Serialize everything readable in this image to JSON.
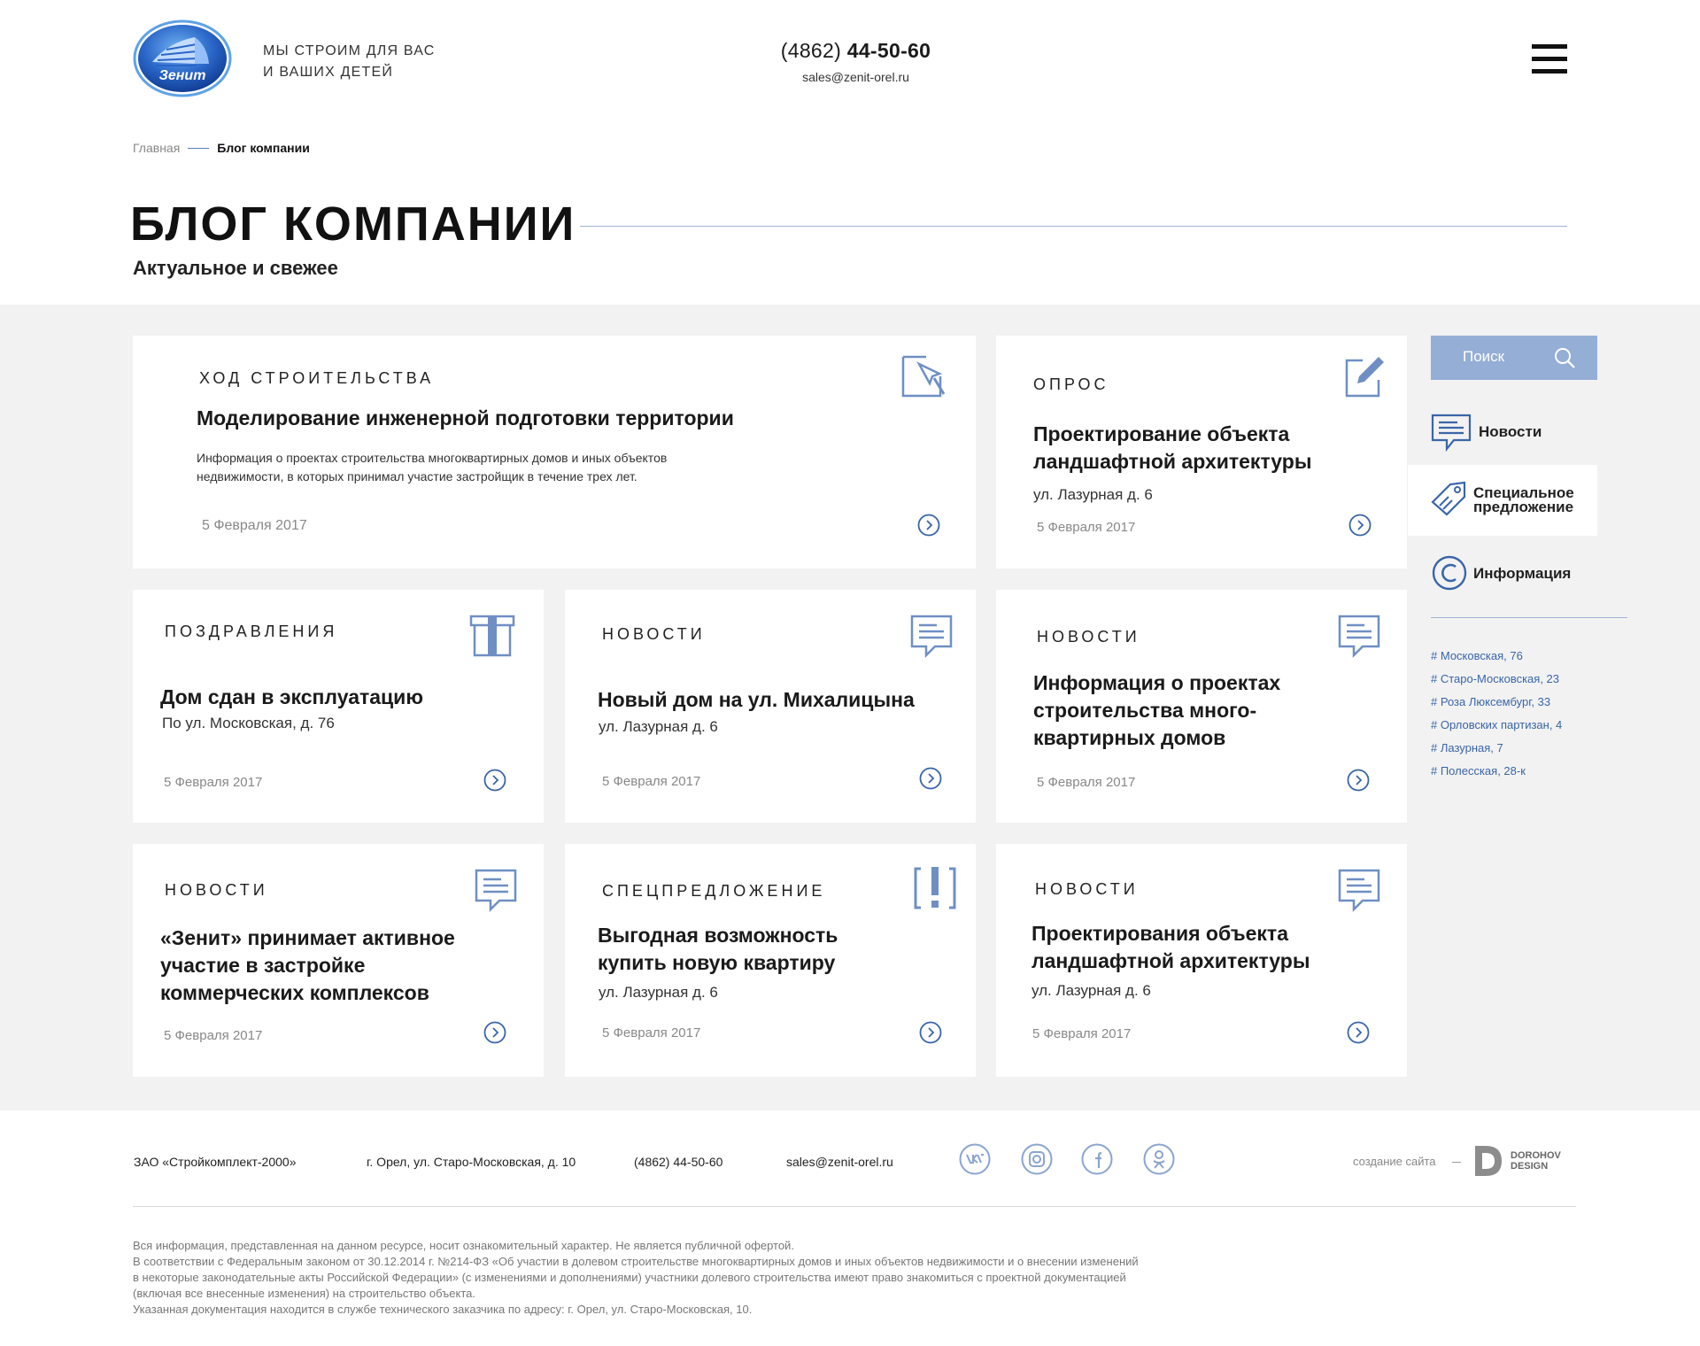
{
  "header": {
    "logo_text": "Зенит",
    "slogan_line1": "МЫ СТРОИМ ДЛЯ ВАС",
    "slogan_line2": "И ВАШИХ ДЕТЕЙ",
    "phone_code": "(4862) ",
    "phone_number": "44-50-60",
    "email": "sales@zenit-orel.ru",
    "menu_icon": "hamburger-icon"
  },
  "breadcrumb": {
    "home": "Главная",
    "current": "Блог компании"
  },
  "page": {
    "title": "БЛОГ КОМПАНИИ",
    "subtitle": "Актуальное и свежее"
  },
  "cards": [
    {
      "category": "ХОД СТРОИТЕЛЬСТВА",
      "title": "Моделирование инженерной подготовки территории",
      "desc_line1": "Информация о проектах строительства многоквартирных домов и иных объектов",
      "desc_line2": "недвижимости, в которых принимал участие застройщик в течение трех лет.",
      "date": "5 Февраля 2017",
      "icon": "construction-plan-icon"
    },
    {
      "category": "ОПРОС",
      "title_line1": "Проектирование объекта",
      "title_line2": "ландшафтной архитектуры",
      "address": "ул. Лазурная д. 6",
      "date": "5 Февраля 2017",
      "icon": "poll-edit-icon"
    },
    {
      "category": "ПОЗДРАВЛЕНИЯ",
      "title": "Дом сдан в эксплуатацию",
      "address": "По ул. Московская, д. 76",
      "date": "5 Февраля 2017",
      "icon": "gift-icon"
    },
    {
      "category": "НОВОСТИ",
      "title": "Новый дом на ул. Михалицына",
      "address": "ул. Лазурная д. 6",
      "date": "5 Февраля 2017",
      "icon": "news-document-icon"
    },
    {
      "category": "НОВОСТИ",
      "title_line1": "Информация о проектах",
      "title_line2": "строительства много-",
      "title_line3": "квартирных домов",
      "date": "5 Февраля 2017",
      "icon": "news-document-icon"
    },
    {
      "category": "НОВОСТИ",
      "title_line1": "«Зенит» принимает активное",
      "title_line2": "участие в застройке",
      "title_line3": "коммерческих комплексов",
      "date": "5 Февраля 2017",
      "icon": "news-document-icon"
    },
    {
      "category": "СПЕЦПРЕДЛОЖЕНИЕ",
      "title_line1": "Выгодная возможность",
      "title_line2": "купить новую квартиру",
      "address": "ул. Лазурная д. 6",
      "date": "5 Февраля 2017",
      "icon": "exclamation-icon"
    },
    {
      "category": "НОВОСТИ",
      "title_line1": "Проектирования объекта",
      "title_line2": "ландшафтной архитектуры",
      "address": "ул. Лазурная д. 6",
      "date": "5 Февраля 2017",
      "icon": "news-document-icon"
    }
  ],
  "sidebar": {
    "search_label": "Поиск",
    "items": [
      {
        "label": "Новости",
        "icon": "news-icon"
      },
      {
        "label_line1": "Специальное",
        "label_line2": "предложение",
        "icon": "tag-icon"
      },
      {
        "label": "Информация",
        "icon": "copyright-icon"
      }
    ],
    "tags": [
      "# Московская, 76",
      "# Старо-Московская, 23",
      "# Роза Люксембург, 33",
      "# Орловских партизан, 4",
      "# Лазурная, 7",
      "# Полесская, 28-к"
    ]
  },
  "footer": {
    "company": "ЗАО «Стройкомплект-2000»",
    "address": "г. Орел, ул. Старо-Московская, д. 10",
    "phone": "(4862) 44-50-60",
    "email": "sales@zenit-orel.ru",
    "socials": [
      "vk-icon",
      "instagram-icon",
      "facebook-icon",
      "odnoklassniki-icon"
    ],
    "credit": "создание сайта",
    "dev_line1": "DOROHOV",
    "dev_line2": "DESIGN",
    "disclaimer": [
      "Вся информация, представленная на данном ресурсе, носит ознакомительный характер. Не является публичной офертой.",
      "В соответствии с Федеральным законом от 30.12.2014 г. №214-ФЗ «Об участии в долевом строительстве многоквартирных домов и иных объектов недвижимости и о внесении изменений",
      "в некоторые законодательные акты Российской Федерации» (с изменениями и дополнениями) участники долевого строительства имеют право знакомиться с проектной документацией",
      "(включая все внесенные изменения) на строительство объекта.",
      "Указанная документация находится в службе технического заказчика по адресу: г. Орел, ул. Старо-Московская, 10."
    ]
  },
  "colors": {
    "accent": "#3a65a8",
    "search_bg": "#95aed6",
    "gray_bg": "#f2f2f2"
  }
}
